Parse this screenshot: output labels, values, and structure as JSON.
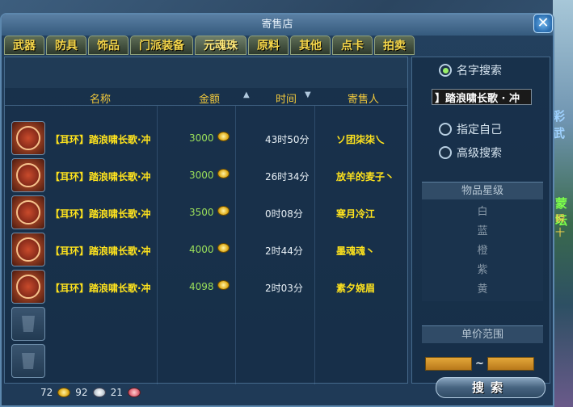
{
  "window": {
    "title": "寄售店",
    "close_label": "✕"
  },
  "tabs": [
    {
      "label": "武器"
    },
    {
      "label": "防具"
    },
    {
      "label": "饰品"
    },
    {
      "label": "门派装备"
    },
    {
      "label": "元魂珠"
    },
    {
      "label": "原料"
    },
    {
      "label": "其他"
    },
    {
      "label": "点卡"
    },
    {
      "label": "拍卖"
    }
  ],
  "active_tab": "元魂珠",
  "columns": {
    "name": "名称",
    "price": "金额",
    "time": "时间",
    "seller": "寄售人"
  },
  "sort": {
    "price": "ascending",
    "time": "descending"
  },
  "listings": [
    {
      "name": "【耳环】踏浪啸长歌·冲",
      "price": "3000",
      "time": "43时50分",
      "seller": "ソ团柒柒乀"
    },
    {
      "name": "【耳环】踏浪啸长歌·冲",
      "price": "3000",
      "time": "26时34分",
      "seller": "放羊的麦子丶"
    },
    {
      "name": "【耳环】踏浪啸长歌·冲",
      "price": "3500",
      "time": "0时08分",
      "seller": "寒月冷江"
    },
    {
      "name": "【耳环】踏浪啸长歌·冲",
      "price": "4000",
      "time": "2时44分",
      "seller": "墨魂魂丶"
    },
    {
      "name": "【耳环】踏浪啸长歌·冲",
      "price": "4098",
      "time": "2时03分",
      "seller": "素夕娆眉"
    }
  ],
  "currency": {
    "gold": "72",
    "silver": "92",
    "red": "21"
  },
  "search": {
    "name_search_label": "名字搜索",
    "query": "】踏浪啸长歌 · 冲",
    "specify_self_label": "指定自己",
    "advanced_label": "高级搜索",
    "selected_mode": "名字搜索",
    "grade_title": "物品星级",
    "grades": [
      "白",
      "蓝",
      "橙",
      "紫",
      "黄"
    ],
    "price_range_title": "单价范围",
    "price_min": "",
    "price_max": "",
    "button_label": "搜索"
  },
  "colors": {
    "accent_gold": "#ffe31d",
    "price_green": "#9be05a",
    "tab_text": "#f5d64a"
  },
  "scenery_text": {
    "line1": "彩武",
    "line2": "蒙坛",
    "line3": "瞬十"
  }
}
